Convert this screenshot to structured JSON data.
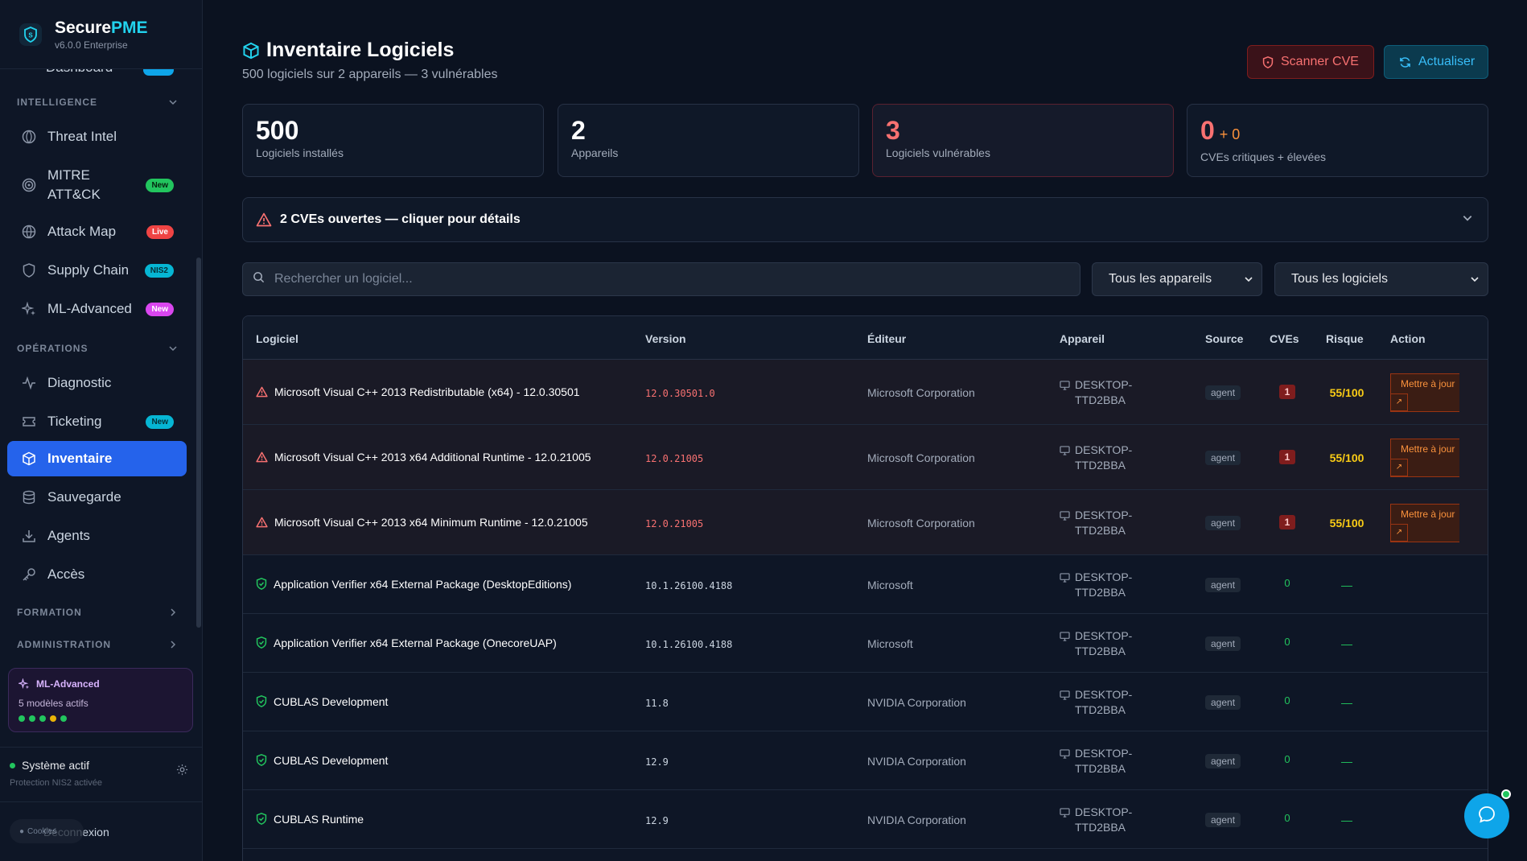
{
  "brand": {
    "name_part1": "Secure",
    "name_part2": "PME",
    "version": "v6.0.0 Enterprise"
  },
  "sidebar": {
    "partial_item": "Dashboard",
    "sections": {
      "intelligence": "INTELLIGENCE",
      "operations": "OPÉRATIONS",
      "formation": "FORMATION",
      "administration": "ADMINISTRATION"
    },
    "items": [
      {
        "label": "Threat Intel",
        "badge": ""
      },
      {
        "label": "MITRE ATT&CK",
        "badge": "New"
      },
      {
        "label": "Attack Map",
        "badge": "Live"
      },
      {
        "label": "Supply Chain",
        "badge": "NIS2"
      },
      {
        "label": "ML-Advanced",
        "badge": "New"
      },
      {
        "label": "Diagnostic",
        "badge": ""
      },
      {
        "label": "Ticketing",
        "badge": "New"
      },
      {
        "label": "Inventaire",
        "badge": ""
      },
      {
        "label": "Sauvegarde",
        "badge": ""
      },
      {
        "label": "Agents",
        "badge": ""
      },
      {
        "label": "Accès",
        "badge": ""
      }
    ],
    "ml_card": {
      "title": "ML-Advanced",
      "subtitle": "5 modèles actifs"
    },
    "system": {
      "status": "Système actif",
      "sub": "Protection NIS2 activée"
    },
    "logout": "Déconnexion",
    "cookie_chip": "Cookies"
  },
  "header": {
    "title": "Inventaire Logiciels",
    "subtitle": "500 logiciels sur 2 appareils — 3 vulnérables",
    "scan_button": "Scanner CVE",
    "refresh_button": "Actualiser"
  },
  "stats": [
    {
      "value": "500",
      "label": "Logiciels installés"
    },
    {
      "value": "2",
      "label": "Appareils"
    },
    {
      "value": "3",
      "label": "Logiciels vulnérables"
    },
    {
      "value": "0",
      "extra": "+ 0",
      "label": "CVEs critiques + élevées"
    }
  ],
  "alert": {
    "text": "2 CVEs ouvertes — cliquer pour détails"
  },
  "filters": {
    "search_placeholder": "Rechercher un logiciel...",
    "device_select": "Tous les appareils",
    "software_select": "Tous les logiciels"
  },
  "table": {
    "columns": [
      "Logiciel",
      "Version",
      "Éditeur",
      "Appareil",
      "Source",
      "CVEs",
      "Risque",
      "Action"
    ],
    "action_label": "Mettre à jour",
    "action_arrow": "↗",
    "rows": [
      {
        "name": "Microsoft Visual C++ 2013 Redistributable (x64) - 12.0.30501",
        "version": "12.0.30501.0",
        "publisher": "Microsoft Corporation",
        "device_l1": "DESKTOP-",
        "device_l2": "TTD2BBA",
        "source": "agent",
        "cves": "1",
        "risk": "55/100",
        "vulnerable": true
      },
      {
        "name": "Microsoft Visual C++ 2013 x64 Additional Runtime - 12.0.21005",
        "version": "12.0.21005",
        "publisher": "Microsoft Corporation",
        "device_l1": "DESKTOP-",
        "device_l2": "TTD2BBA",
        "source": "agent",
        "cves": "1",
        "risk": "55/100",
        "vulnerable": true
      },
      {
        "name": "Microsoft Visual C++ 2013 x64 Minimum Runtime - 12.0.21005",
        "version": "12.0.21005",
        "publisher": "Microsoft Corporation",
        "device_l1": "DESKTOP-",
        "device_l2": "TTD2BBA",
        "source": "agent",
        "cves": "1",
        "risk": "55/100",
        "vulnerable": true
      },
      {
        "name": "Application Verifier x64 External Package (DesktopEditions)",
        "version": "10.1.26100.4188",
        "publisher": "Microsoft",
        "device_l1": "DESKTOP-",
        "device_l2": "TTD2BBA",
        "source": "agent",
        "cves": "0",
        "risk": "—",
        "vulnerable": false
      },
      {
        "name": "Application Verifier x64 External Package (OnecoreUAP)",
        "version": "10.1.26100.4188",
        "publisher": "Microsoft",
        "device_l1": "DESKTOP-",
        "device_l2": "TTD2BBA",
        "source": "agent",
        "cves": "0",
        "risk": "—",
        "vulnerable": false
      },
      {
        "name": "CUBLAS Development",
        "version": "11.8",
        "publisher": "NVIDIA Corporation",
        "device_l1": "DESKTOP-",
        "device_l2": "TTD2BBA",
        "source": "agent",
        "cves": "0",
        "risk": "—",
        "vulnerable": false
      },
      {
        "name": "CUBLAS Development",
        "version": "12.9",
        "publisher": "NVIDIA Corporation",
        "device_l1": "DESKTOP-",
        "device_l2": "TTD2BBA",
        "source": "agent",
        "cves": "0",
        "risk": "—",
        "vulnerable": false
      },
      {
        "name": "CUBLAS Runtime",
        "version": "12.9",
        "publisher": "NVIDIA Corporation",
        "device_l1": "DESKTOP-",
        "device_l2": "TTD2BBA",
        "source": "agent",
        "cves": "0",
        "risk": "—",
        "vulnerable": false
      }
    ]
  }
}
